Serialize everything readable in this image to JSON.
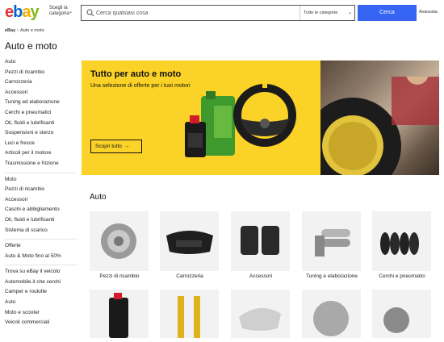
{
  "header": {
    "logo_letters": [
      "e",
      "b",
      "a",
      "y"
    ],
    "shop_by_category": "Scegli la categoria",
    "search_placeholder": "Cerca qualsiasi cosa",
    "category_select": "Tutte le categorie",
    "search_button": "Cerca",
    "advanced": "Avanzata"
  },
  "breadcrumb": [
    "eBay",
    "Auto e moto"
  ],
  "page_title": "Auto e moto",
  "sidebar": {
    "group_auto": [
      "Auto",
      "Pezzi di ricambio",
      "Carrozzeria",
      "Accessori",
      "Tuning ed elaborazione",
      "Cerchi e pneumatici",
      "Oli, fluidi e lubrificanti",
      "Sospensioni e sterzo",
      "Luci e frecce",
      "Articoli per il motore",
      "Trasmissione e frizione"
    ],
    "group_moto": [
      "Moto",
      "Pezzi di ricambio",
      "Accessori",
      "Caschi e abbigliamento",
      "Oli, fluidi e lubrificanti",
      "Sistema di scarico"
    ],
    "group_offers": [
      "Offerte",
      "Auto & Moto fino al 50%"
    ],
    "group_other": [
      "Trova su eBay il veicolo",
      "Automobile.it che cerchi",
      "Camper e roulotte",
      "Auto",
      "Moto e scooter",
      "Veicoli commerciali"
    ]
  },
  "hero": {
    "title": "Tutto per auto e moto",
    "subtitle": "Una selezione di offerte per i tuoi motori",
    "button": "Scopri tutto",
    "button_arrow": "→",
    "accent": "#fbd227"
  },
  "section": {
    "title": "Auto",
    "tiles": [
      "Pezzi di ricambio",
      "Carrozzeria",
      "Accessori",
      "Tuning e elaborazione",
      "Cerchi e pneumatici"
    ]
  },
  "colors": {
    "brand_blue": "#3665f3",
    "logo_red": "#e53238",
    "logo_blue": "#0064d2",
    "logo_yellow": "#f5af02",
    "logo_green": "#86b817"
  }
}
